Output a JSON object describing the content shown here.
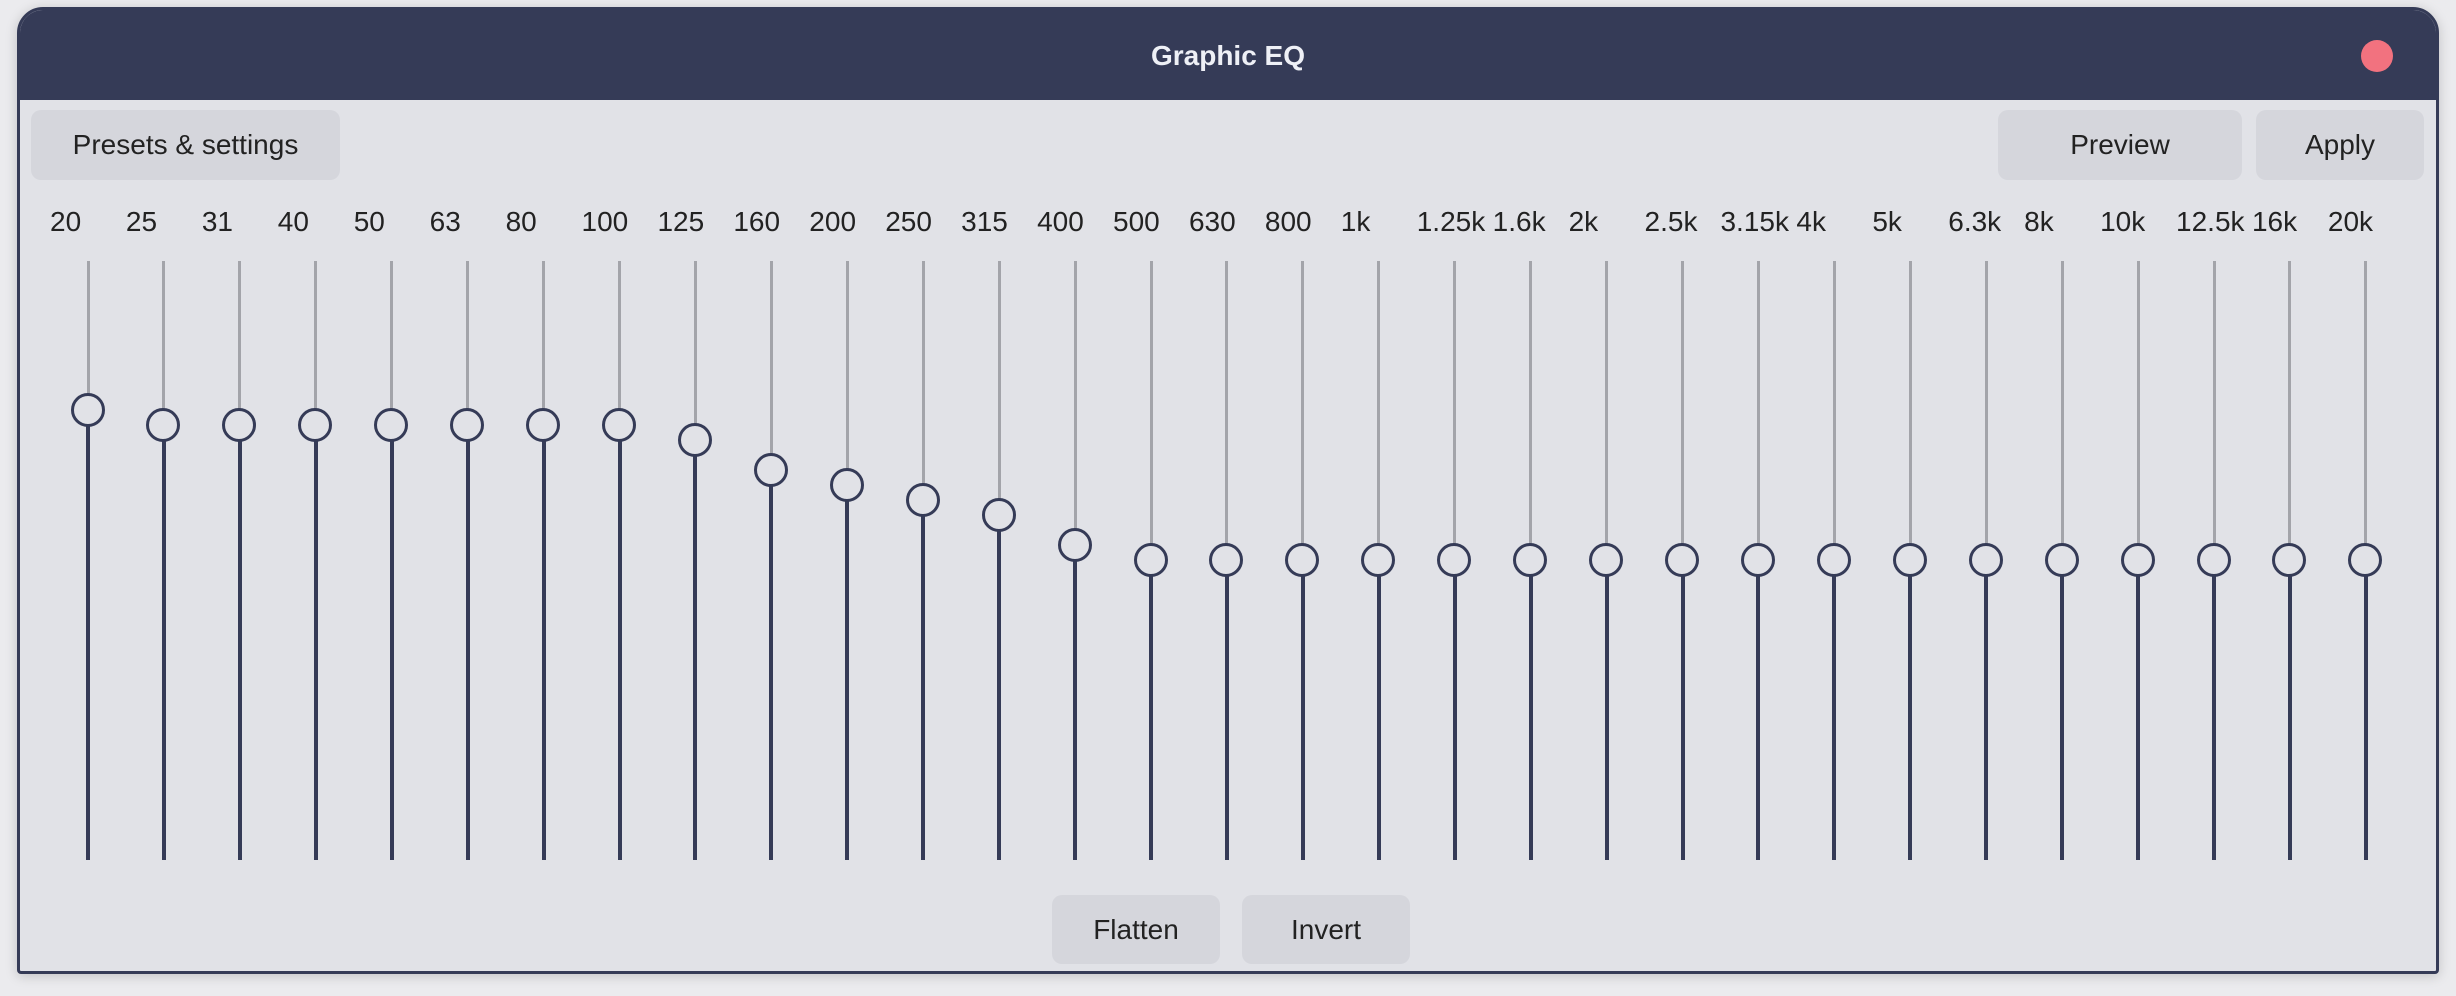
{
  "window": {
    "title": "Graphic EQ",
    "close_icon": "close-dot",
    "close_color": "#f2727f",
    "titlebar_color": "#353b57"
  },
  "toolbar": {
    "presets_label": "Presets & settings",
    "preview_label": "Preview",
    "apply_label": "Apply"
  },
  "footer": {
    "flatten_label": "Flatten",
    "invert_label": "Invert"
  },
  "eq": {
    "range_db": [
      -20,
      20
    ],
    "bands": [
      {
        "label": "20",
        "gain_db": 10
      },
      {
        "label": "25",
        "gain_db": 9
      },
      {
        "label": "31",
        "gain_db": 9
      },
      {
        "label": "40",
        "gain_db": 9
      },
      {
        "label": "50",
        "gain_db": 9
      },
      {
        "label": "63",
        "gain_db": 9
      },
      {
        "label": "80",
        "gain_db": 9
      },
      {
        "label": "100",
        "gain_db": 9
      },
      {
        "label": "125",
        "gain_db": 8
      },
      {
        "label": "160",
        "gain_db": 6
      },
      {
        "label": "200",
        "gain_db": 5
      },
      {
        "label": "250",
        "gain_db": 4
      },
      {
        "label": "315",
        "gain_db": 3
      },
      {
        "label": "400",
        "gain_db": 1
      },
      {
        "label": "500",
        "gain_db": 0
      },
      {
        "label": "630",
        "gain_db": 0
      },
      {
        "label": "800",
        "gain_db": 0
      },
      {
        "label": "1k",
        "gain_db": 0
      },
      {
        "label": "1.25k",
        "gain_db": 0
      },
      {
        "label": "1.6k",
        "gain_db": 0
      },
      {
        "label": "2k",
        "gain_db": 0
      },
      {
        "label": "2.5k",
        "gain_db": 0
      },
      {
        "label": "3.15k",
        "gain_db": 0
      },
      {
        "label": "4k",
        "gain_db": 0
      },
      {
        "label": "5k",
        "gain_db": 0
      },
      {
        "label": "6.3k",
        "gain_db": 0
      },
      {
        "label": "8k",
        "gain_db": 0
      },
      {
        "label": "10k",
        "gain_db": 0
      },
      {
        "label": "12.5k",
        "gain_db": 0
      },
      {
        "label": "16k",
        "gain_db": 0
      },
      {
        "label": "20k",
        "gain_db": 0
      }
    ]
  }
}
